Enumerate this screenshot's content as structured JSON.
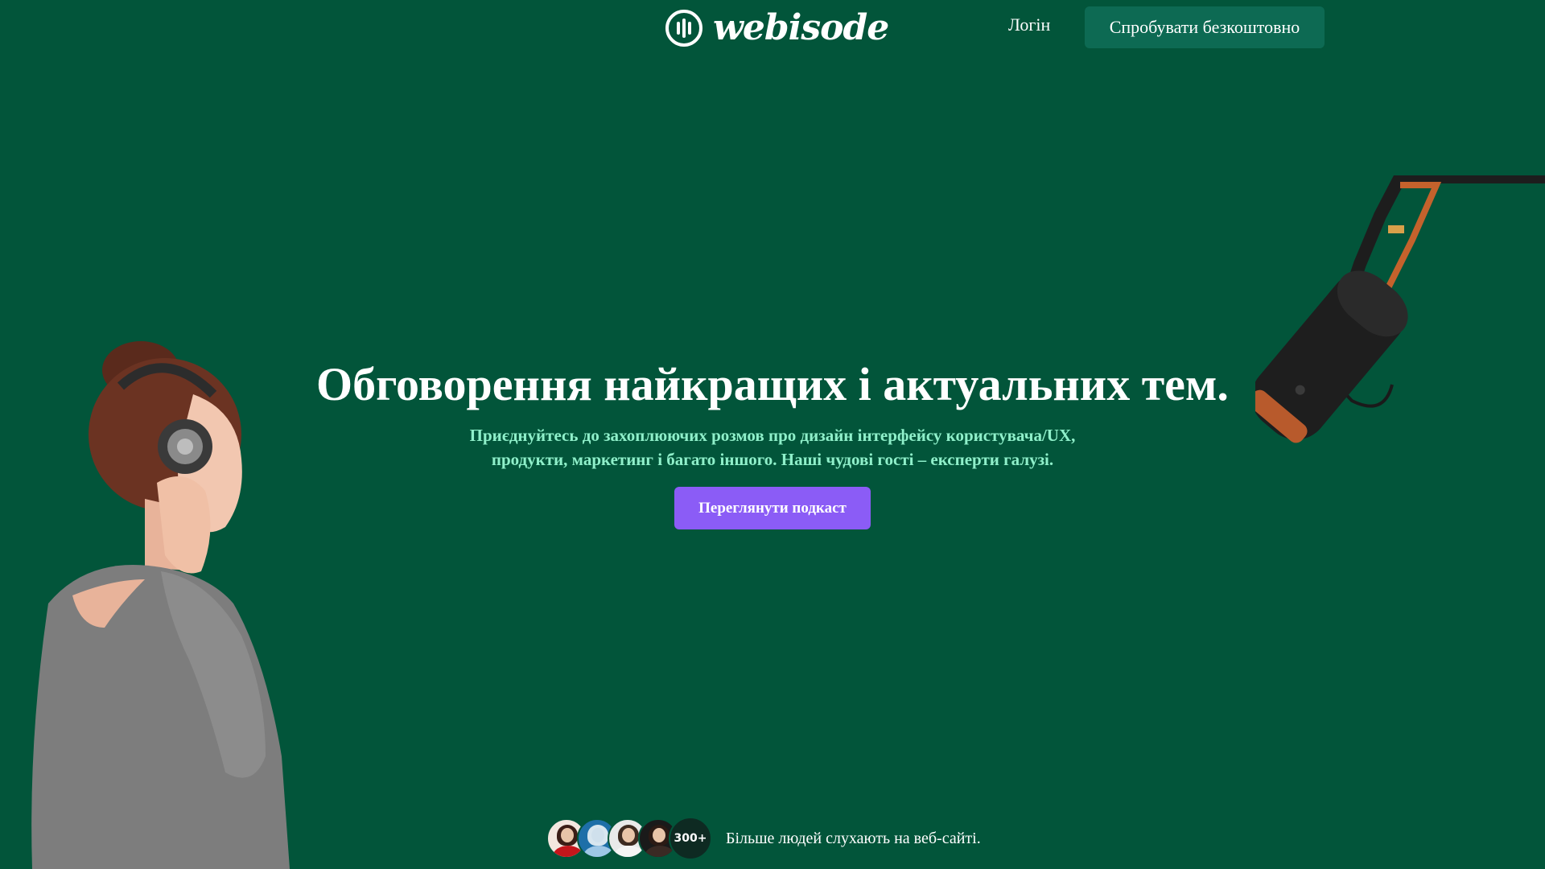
{
  "header": {
    "logo_text": "webisode",
    "login_label": "Логін",
    "cta_label": "Спробувати безкоштовно"
  },
  "hero": {
    "title": "Обговорення найкращих і актуальних тем.",
    "subtitle_line1": "Приєднуйтесь до захоплюючих розмов про дизайн інтерфейсу користувача/UX,",
    "subtitle_line2": "продукти, маркетинг і багато іншого. Наші чудові гості – експерти галузі.",
    "button_label": "Переглянути подкаст"
  },
  "social_proof": {
    "count": "300+",
    "text": "Більше людей слухають на веб-сайті."
  },
  "colors": {
    "background": "#02553a",
    "cta_background": "#0d6a53",
    "primary_button": "#8b5cf6",
    "subtitle": "#8ff0ca"
  },
  "icons": {
    "logo": "soundwave-circle-icon"
  }
}
